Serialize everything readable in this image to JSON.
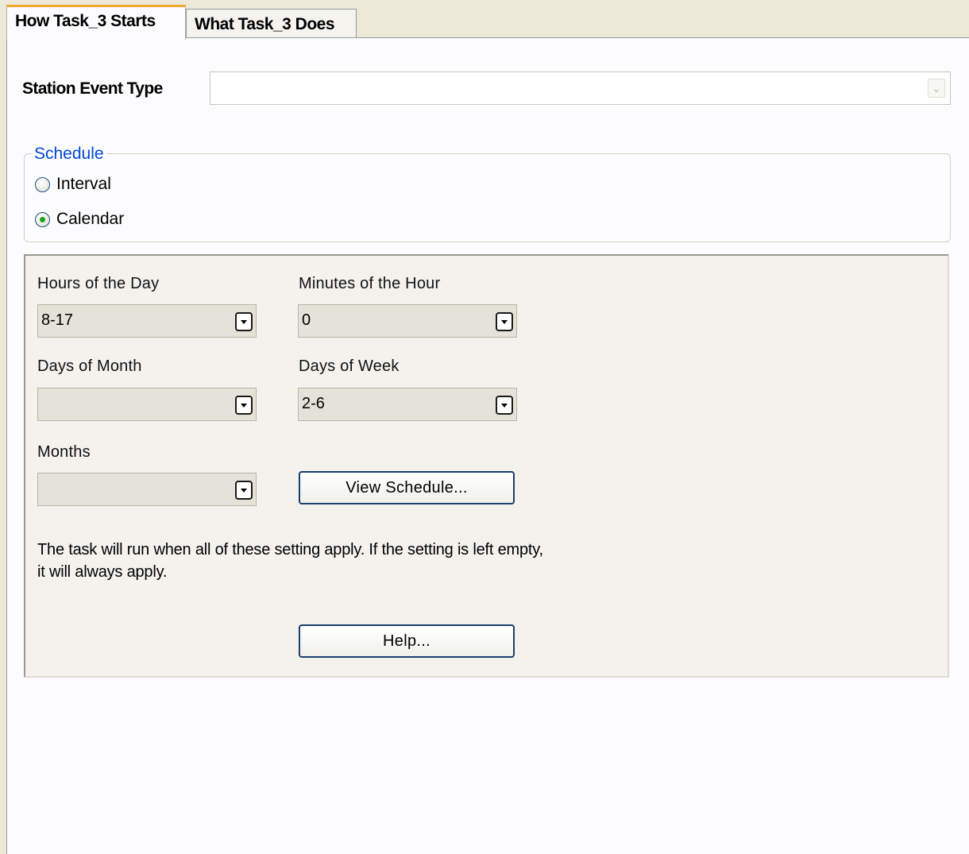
{
  "tabs": [
    {
      "label": "How Task_3 Starts",
      "active": true
    },
    {
      "label": "What Task_3 Does",
      "active": false
    }
  ],
  "station_event": {
    "label": "Station Event Type",
    "value": ""
  },
  "schedule": {
    "legend": "Schedule",
    "options": [
      {
        "label": "Interval",
        "checked": false
      },
      {
        "label": "Calendar",
        "checked": true
      }
    ]
  },
  "calendar": {
    "hours": {
      "label": "Hours of the Day",
      "value": "8-17"
    },
    "minutes": {
      "label": "Minutes of the Hour",
      "value": "0"
    },
    "days_of_month": {
      "label": "Days of Month",
      "value": ""
    },
    "days_of_week": {
      "label": "Days of Week",
      "value": "2-6"
    },
    "months": {
      "label": "Months",
      "value": ""
    },
    "view_schedule_label": "View Schedule...",
    "note": "The task will run when all of these setting apply. If the setting is left empty, it will always apply.",
    "help_label": "Help..."
  },
  "colors": {
    "accent_tab": "#f2a832",
    "legend": "#0046d5",
    "radio_dot": "#21a121"
  }
}
